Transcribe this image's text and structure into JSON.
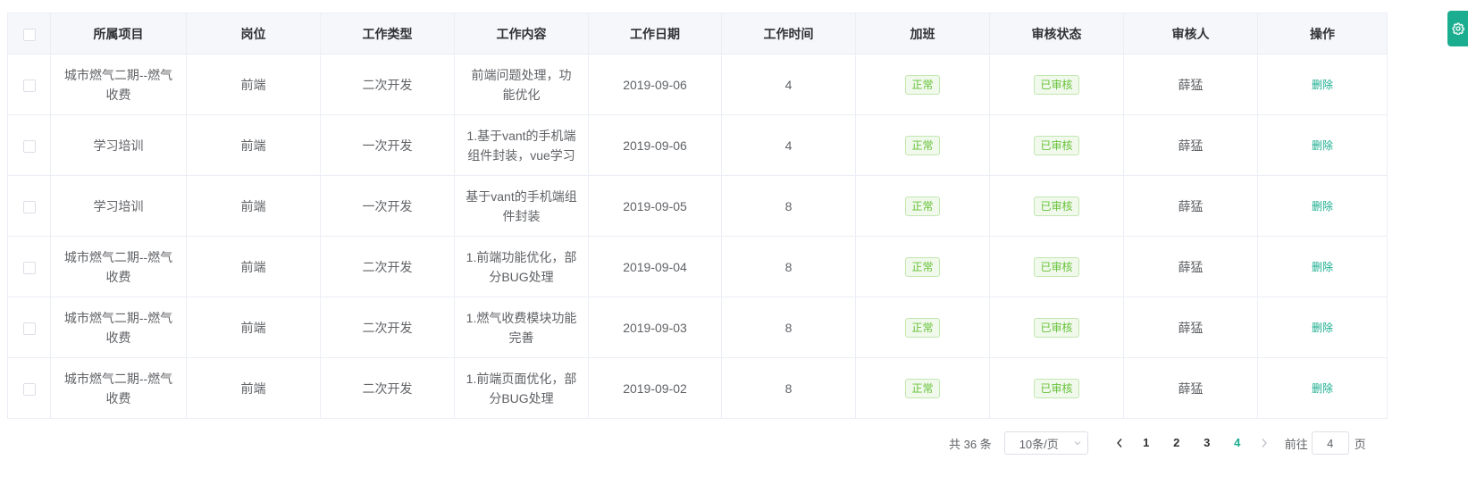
{
  "table": {
    "headers": [
      "所属项目",
      "岗位",
      "工作类型",
      "工作内容",
      "工作日期",
      "工作时间",
      "加班",
      "审核状态",
      "审核人",
      "操作"
    ],
    "rows": [
      {
        "project": "城市燃气二期--燃气收费",
        "post": "前端",
        "type": "二次开发",
        "content": "前端问题处理，功能优化",
        "date": "2019-09-06",
        "hours": "4",
        "overtime": "正常",
        "status": "已审核",
        "reviewer": "薛猛",
        "action": "删除"
      },
      {
        "project": "学习培训",
        "post": "前端",
        "type": "一次开发",
        "content": "1.基于vant的手机端组件封装，vue学习",
        "date": "2019-09-06",
        "hours": "4",
        "overtime": "正常",
        "status": "已审核",
        "reviewer": "薛猛",
        "action": "删除"
      },
      {
        "project": "学习培训",
        "post": "前端",
        "type": "一次开发",
        "content": "基于vant的手机端组件封装",
        "date": "2019-09-05",
        "hours": "8",
        "overtime": "正常",
        "status": "已审核",
        "reviewer": "薛猛",
        "action": "删除"
      },
      {
        "project": "城市燃气二期--燃气收费",
        "post": "前端",
        "type": "二次开发",
        "content": "1.前端功能优化，部分BUG处理",
        "date": "2019-09-04",
        "hours": "8",
        "overtime": "正常",
        "status": "已审核",
        "reviewer": "薛猛",
        "action": "删除"
      },
      {
        "project": "城市燃气二期--燃气收费",
        "post": "前端",
        "type": "二次开发",
        "content": "1.燃气收费模块功能完善",
        "date": "2019-09-03",
        "hours": "8",
        "overtime": "正常",
        "status": "已审核",
        "reviewer": "薛猛",
        "action": "删除"
      },
      {
        "project": "城市燃气二期--燃气收费",
        "post": "前端",
        "type": "二次开发",
        "content": "1.前端页面优化，部分BUG处理",
        "date": "2019-09-02",
        "hours": "8",
        "overtime": "正常",
        "status": "已审核",
        "reviewer": "薛猛",
        "action": "删除"
      }
    ]
  },
  "pagination": {
    "total_text": "共 36 条",
    "page_size": "10条/页",
    "pages": [
      "1",
      "2",
      "3",
      "4"
    ],
    "current_page": "4",
    "goto_label": "前往",
    "goto_value": "4",
    "goto_suffix": "页"
  },
  "icons": {
    "settings": "gear-icon",
    "prev": "chevron-left-icon",
    "next": "chevron-right-icon",
    "dropdown": "chevron-down-icon"
  },
  "colors": {
    "accent": "#1aad8f",
    "success": "#67c23a",
    "header_bg": "#f5f7fa",
    "border": "#ebeef5"
  }
}
